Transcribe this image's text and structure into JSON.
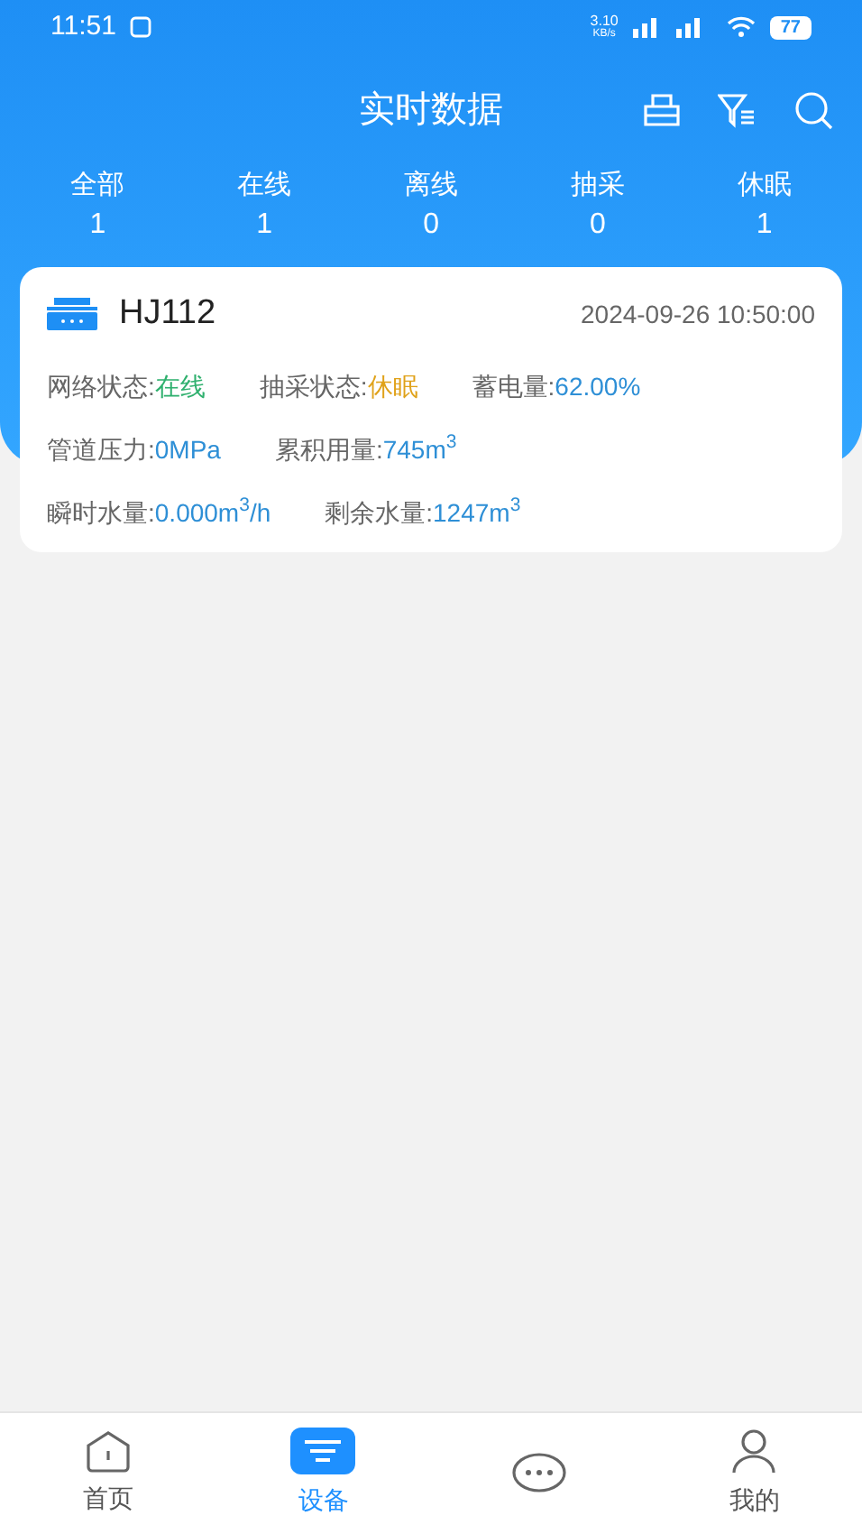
{
  "status_bar": {
    "time": "11:51",
    "speed": "3.10",
    "speed_unit": "KB/s",
    "battery": "77"
  },
  "header": {
    "title": "实时数据"
  },
  "summary": [
    {
      "label": "全部",
      "count": "1"
    },
    {
      "label": "在线",
      "count": "1"
    },
    {
      "label": "离线",
      "count": "0"
    },
    {
      "label": "抽采",
      "count": "0"
    },
    {
      "label": "休眠",
      "count": "1"
    }
  ],
  "devices": [
    {
      "name": "HJ112",
      "time": "2024-09-26 10:50:00",
      "rows": [
        [
          {
            "label": "网络状态:",
            "value": "在线",
            "color": "#2fb06e"
          },
          {
            "label": "抽采状态:",
            "value": "休眠",
            "color": "#e0a21a"
          },
          {
            "label": "蓄电量:",
            "value": "62.00%",
            "color": "#2e8fd6"
          }
        ],
        [
          {
            "label": "管道压力:",
            "value": "0MPa",
            "color": "#2e8fd6"
          },
          {
            "label": "累积用量:",
            "value": "745m$^{3}$",
            "color": "#2e8fd6"
          }
        ],
        [
          {
            "label": "瞬时水量:",
            "value": "0.000m$^{3}$/h",
            "color": "#2e8fd6"
          },
          {
            "label": "剩余水量:",
            "value": "1247m$^{3}$",
            "color": "#2e8fd6"
          }
        ]
      ]
    }
  ],
  "nav": [
    {
      "kind": "home",
      "label": "首页",
      "selected": false
    },
    {
      "kind": "device",
      "label": "设备",
      "selected": true
    },
    {
      "kind": "chat",
      "selected": false
    },
    {
      "kind": "me",
      "label": "我的",
      "selected": false
    }
  ]
}
